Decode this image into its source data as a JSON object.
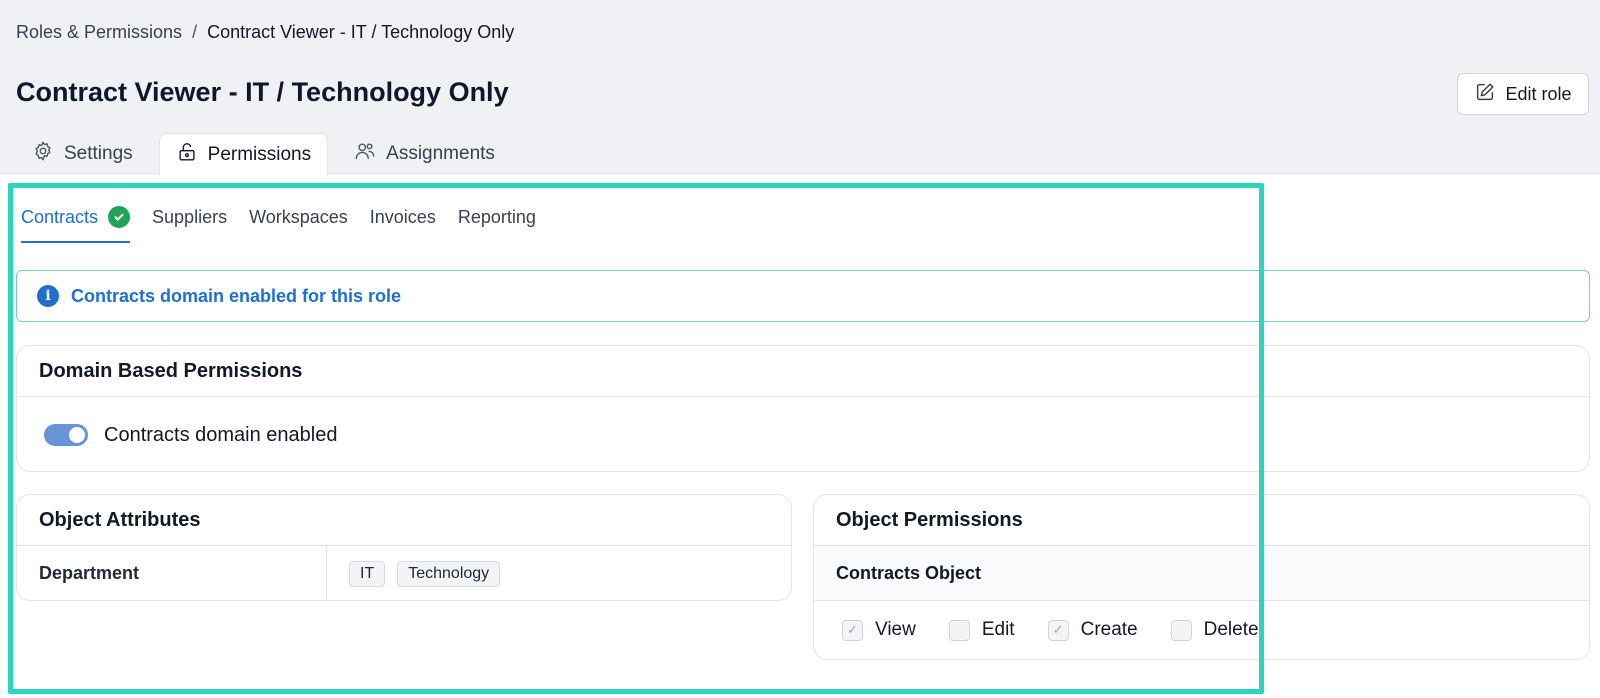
{
  "breadcrumb": {
    "parent": "Roles & Permissions",
    "separator": "/",
    "current": "Contract Viewer - IT / Technology Only"
  },
  "page_title": "Contract Viewer - IT / Technology Only",
  "edit_button": {
    "label": "Edit role",
    "icon": "pencil-square-icon"
  },
  "main_tabs": [
    {
      "label": "Settings",
      "icon": "gear-icon",
      "active": false
    },
    {
      "label": "Permissions",
      "icon": "lock-icon",
      "active": true
    },
    {
      "label": "Assignments",
      "icon": "users-icon",
      "active": false
    }
  ],
  "domain_tabs": [
    {
      "label": "Contracts",
      "active": true,
      "enabled_icon": "check-circle-icon"
    },
    {
      "label": "Suppliers",
      "active": false
    },
    {
      "label": "Workspaces",
      "active": false
    },
    {
      "label": "Invoices",
      "active": false
    },
    {
      "label": "Reporting",
      "active": false
    }
  ],
  "info_banner": {
    "icon": "info-icon",
    "text": "Contracts domain enabled for this role"
  },
  "domain_permissions": {
    "title": "Domain Based Permissions",
    "toggle_label": "Contracts domain enabled",
    "toggle_on": true
  },
  "object_attributes": {
    "title": "Object Attributes",
    "rows": [
      {
        "name": "Department",
        "values": [
          "IT",
          "Technology"
        ]
      }
    ]
  },
  "object_permissions": {
    "title": "Object Permissions",
    "object_name": "Contracts Object",
    "permissions": [
      {
        "label": "View",
        "checked": true
      },
      {
        "label": "Edit",
        "checked": false
      },
      {
        "label": "Create",
        "checked": true
      },
      {
        "label": "Delete",
        "checked": false
      }
    ]
  },
  "colors": {
    "accent": "#1f6fd1",
    "success": "#22a35a",
    "highlight": "#2dd4bf",
    "header_bg": "#f0f1f4"
  }
}
